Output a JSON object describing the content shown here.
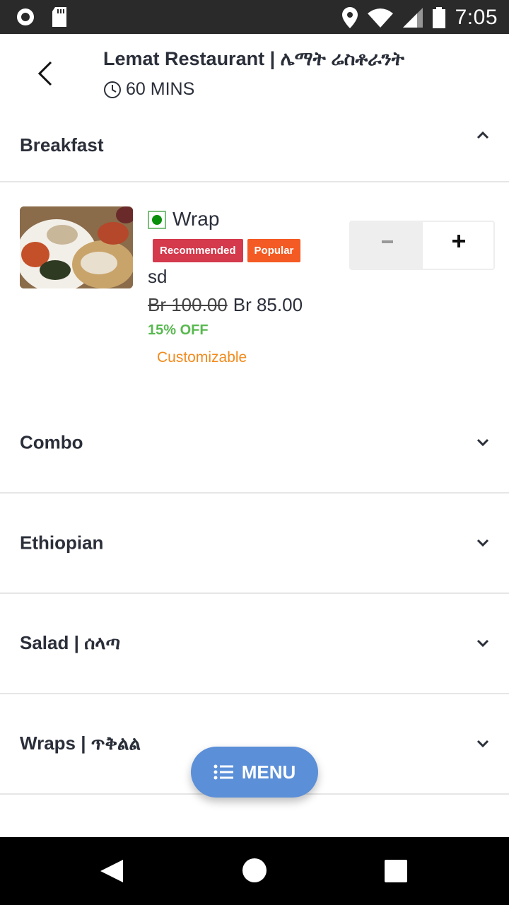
{
  "status_bar": {
    "time": "7:05",
    "icons": [
      "record-icon",
      "sd-card-icon",
      "location-icon",
      "wifi-icon",
      "signal-icon",
      "battery-icon"
    ]
  },
  "header": {
    "title": "Lemat Restaurant | ሌማት ሬስቶራንት",
    "delivery_time": "60 MINS"
  },
  "categories": [
    {
      "name": "Breakfast",
      "expanded": true
    },
    {
      "name": "Combo",
      "expanded": false
    },
    {
      "name": "Ethiopian",
      "expanded": false
    },
    {
      "name": "Salad | ሰላጣ",
      "expanded": false
    },
    {
      "name": "Wraps | ጥቅልል",
      "expanded": false
    }
  ],
  "item": {
    "name": "Wrap",
    "badges": [
      "Recommended",
      "Popular"
    ],
    "description": "sd",
    "old_price": "Br 100.00",
    "price": "Br 85.00",
    "discount": "15% OFF",
    "customizable": "Customizable"
  },
  "menu_button": {
    "label": "MENU"
  },
  "colors": {
    "accent": "#5b8fd8",
    "recommended": "#d4394c",
    "popular": "#f45a23",
    "discount": "#58b84f",
    "customizable": "#f28a1c",
    "veg": "#0a8f0a"
  }
}
